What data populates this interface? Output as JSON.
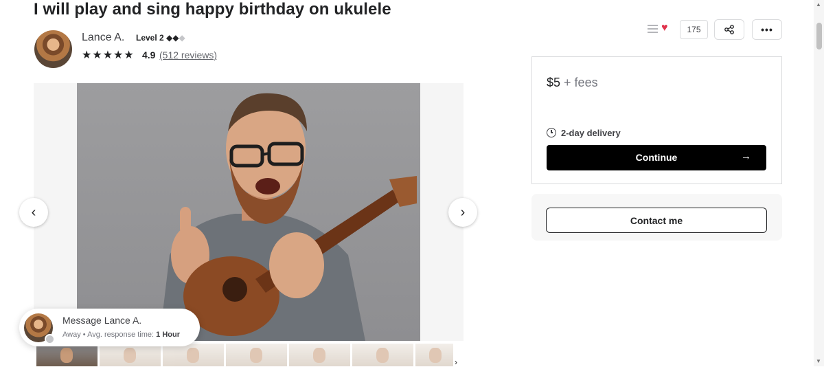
{
  "gig": {
    "title": "I will play and sing happy birthday on ukulele"
  },
  "seller": {
    "name": "Lance A.",
    "level": "Level 2",
    "stars": "★★★★★",
    "rating": "4.9",
    "reviews": "(512 reviews)"
  },
  "actions": {
    "like_count": "175",
    "more_icon": "•••"
  },
  "package": {
    "price": "$5",
    "fees": "+ fees",
    "delivery": "2-day delivery",
    "continue_label": "Continue",
    "continue_arrow": "→"
  },
  "contact": {
    "label": "Contact me"
  },
  "message_card": {
    "title": "Message Lance A.",
    "status": "Away",
    "separator": "•",
    "response_label": "Avg. response time:",
    "response_value": "1 Hour"
  },
  "gallery": {
    "prev_icon": "‹",
    "next_icon": "›",
    "thumb_count": 7,
    "more_thumbs_icon": "›"
  },
  "colors": {
    "heart": "#e0334c",
    "continue_bg": "#000000",
    "accent_text": "#222325"
  },
  "icons": {
    "list": "list-icon",
    "heart": "heart-icon",
    "share": "share-icon",
    "more": "more-icon",
    "clock": "clock-icon"
  }
}
